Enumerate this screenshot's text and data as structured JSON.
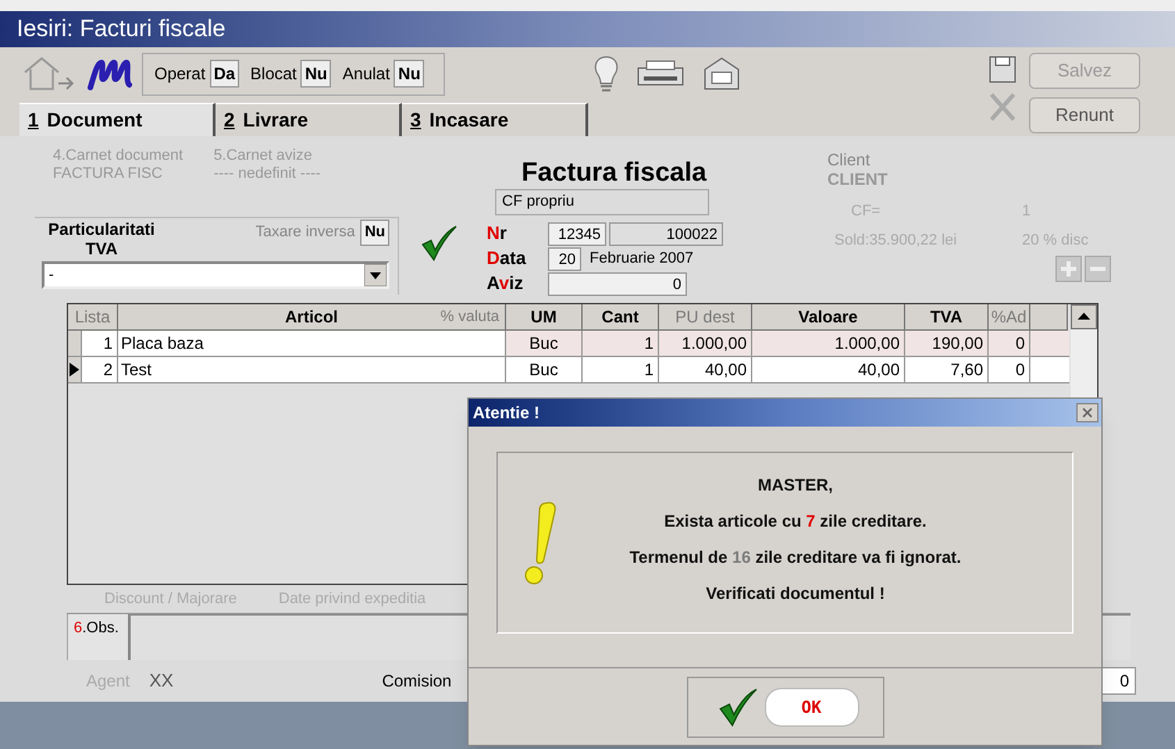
{
  "window": {
    "title": "Iesiri: Facturi fiscale"
  },
  "toolbar": {
    "flags": [
      {
        "label": "Operat",
        "value": "Da"
      },
      {
        "label": "Blocat",
        "value": "Nu"
      },
      {
        "label": "Anulat",
        "value": "Nu"
      }
    ],
    "buttons": [
      {
        "label": "Salvez",
        "disabled": true
      },
      {
        "label": "Renunt",
        "disabled": false
      }
    ]
  },
  "tabs": [
    {
      "number": "1",
      "label": "Document",
      "selected": true
    },
    {
      "number": "2",
      "label": "Livrare",
      "selected": false
    },
    {
      "number": "3",
      "label": "Incasare",
      "selected": false
    }
  ],
  "carnets": [
    {
      "label": "4.Carnet document",
      "value": "FACTURA FISC"
    },
    {
      "label": "5.Carnet avize",
      "value": "---- nedefinit ----"
    }
  ],
  "vat": {
    "title": "Particularitati TVA",
    "taxare_label": "Taxare inversa",
    "taxare_value": "Nu",
    "select_value": "-"
  },
  "document": {
    "title": "Factura fiscala",
    "cf": "CF propriu",
    "fields": [
      {
        "label": [
          {
            "text": "N",
            "accent": true
          },
          {
            "text": "r",
            "accent": false
          }
        ],
        "values": [
          "12345",
          "100022"
        ]
      },
      {
        "label": [
          {
            "text": "D",
            "accent": true
          },
          {
            "text": "ata",
            "accent": false
          }
        ],
        "values": [
          "20",
          "Februarie 2007"
        ]
      },
      {
        "label": [
          {
            "text": "A",
            "accent": false
          },
          {
            "text": "v",
            "accent": true
          },
          {
            "text": "iz",
            "accent": false
          }
        ],
        "values": [
          "0"
        ]
      }
    ]
  },
  "client": {
    "label": "Client",
    "value": "CLIENT",
    "cf_label": "CF=",
    "cf_value": "1",
    "sold": "Sold:35.900,22 lei",
    "discount": "20 % disc"
  },
  "table": {
    "columns": [
      {
        "label": "Lista",
        "disabled": true
      },
      {
        "label": "Articol",
        "sublabel": "% valuta",
        "disabled": false
      },
      {
        "label": "UM",
        "disabled": false
      },
      {
        "label": "Cant",
        "disabled": false
      },
      {
        "label": "PU dest",
        "disabled": true
      },
      {
        "label": "Valoare",
        "disabled": false
      },
      {
        "label": "TVA",
        "disabled": false
      },
      {
        "label": "%Ad",
        "disabled": true
      }
    ],
    "rows": [
      {
        "current": false,
        "cells": [
          "1",
          "Placa baza",
          "Buc",
          "1",
          "1.000,00",
          "1.000,00",
          "190,00",
          "0"
        ]
      },
      {
        "current": true,
        "cells": [
          "2",
          "Test",
          "Buc",
          "1",
          "40,00",
          "40,00",
          "7,60",
          "0"
        ]
      }
    ]
  },
  "footer": {
    "tabs": [
      "Discount / Majorare",
      "Date privind expeditia"
    ],
    "obs_number": "6",
    "obs_label": ".Obs.",
    "agent_label": "Agent",
    "agent_value": "XX",
    "comision_label": "Comision",
    "total": "0"
  },
  "dialog": {
    "title": "Atentie !",
    "lines": [
      [
        {
          "text": "MASTER,"
        }
      ],
      [
        {
          "text": "Exista articole cu "
        },
        {
          "text": "7",
          "color": "#e00000"
        },
        {
          "text": " zile creditare."
        }
      ],
      [
        {
          "text": "Termenul de "
        },
        {
          "text": "16",
          "color": "#7c7c7c"
        },
        {
          "text": " zile creditare va fi ignorat."
        }
      ],
      [
        {
          "text": "Verificati documentul !"
        }
      ]
    ],
    "ok": "OK"
  }
}
